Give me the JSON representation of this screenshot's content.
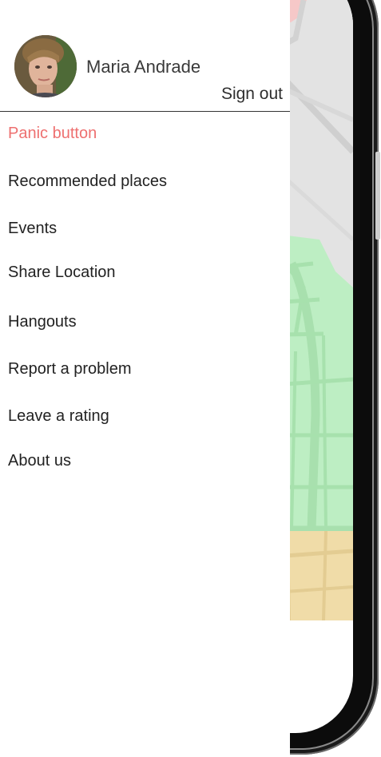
{
  "user": {
    "name": "Maria Andrade",
    "sign_out_label": "Sign out"
  },
  "menu": {
    "items": [
      {
        "label": "Panic button",
        "emphasis": true
      },
      {
        "label": "Recommended places"
      },
      {
        "label": "Events"
      },
      {
        "label": "Share Location"
      },
      {
        "label": "Hangouts"
      },
      {
        "label": "Report a problem"
      },
      {
        "label": "Leave a rating"
      },
      {
        "label": "About us"
      }
    ]
  },
  "colors": {
    "panic_text": "#ee7070",
    "drawer_background": "#ffffff",
    "map_base": "#e3e3e3",
    "map_park": "#bdeec3",
    "map_sand": "#f0dca8",
    "map_alert": "#f6c8c8"
  }
}
